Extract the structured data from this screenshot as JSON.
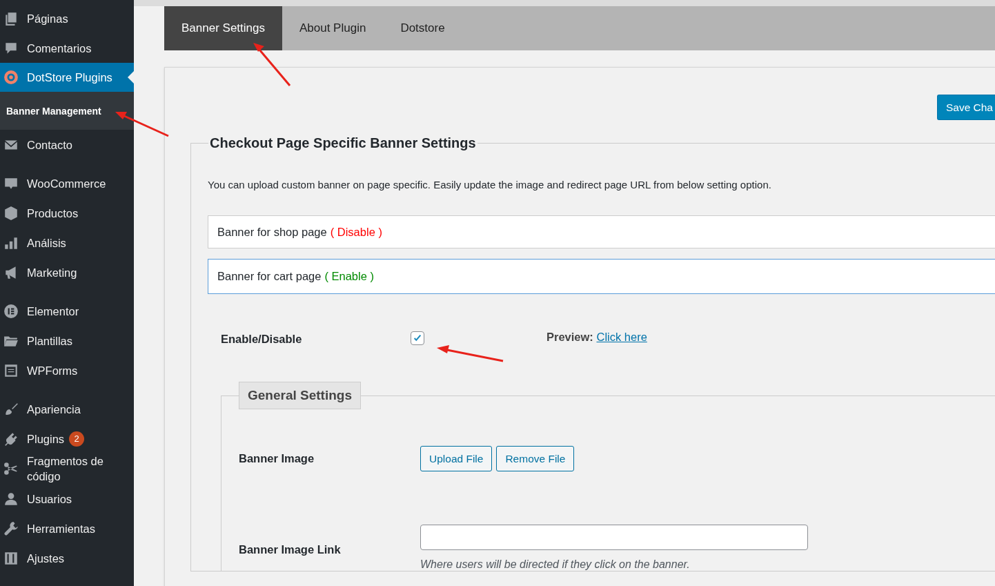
{
  "sidebar": {
    "sections": [
      {
        "items": [
          {
            "label": "Páginas",
            "selected": false
          },
          {
            "label": "Comentarios",
            "selected": false
          },
          {
            "label": "DotStore Plugins",
            "selected": true,
            "children": [
              {
                "label": "Banner Management",
                "selected": true
              }
            ]
          },
          {
            "label": "Contacto",
            "selected": false
          }
        ]
      },
      {
        "items": [
          {
            "label": "WooCommerce",
            "selected": false
          },
          {
            "label": "Productos",
            "selected": false
          },
          {
            "label": "Análisis",
            "selected": false
          },
          {
            "label": "Marketing",
            "selected": false
          }
        ]
      },
      {
        "items": [
          {
            "label": "Elementor",
            "selected": false
          },
          {
            "label": "Plantillas",
            "selected": false
          },
          {
            "label": "WPForms",
            "selected": false
          }
        ]
      },
      {
        "items": [
          {
            "label": "Apariencia",
            "selected": false
          },
          {
            "label": "Plugins",
            "selected": false,
            "badge": "2"
          },
          {
            "label": "Fragmentos de código",
            "selected": false
          },
          {
            "label": "Usuarios",
            "selected": false
          },
          {
            "label": "Herramientas",
            "selected": false
          },
          {
            "label": "Ajustes",
            "selected": false
          }
        ]
      }
    ]
  },
  "tabs": [
    {
      "label": "Banner Settings",
      "selected": true
    },
    {
      "label": "About Plugin",
      "selected": false
    },
    {
      "label": "Dotstore",
      "selected": false
    }
  ],
  "save_button": "Save Cha",
  "settings": {
    "legend": "Checkout Page Specific Banner Settings",
    "description": "You can upload custom banner on page specific. Easily update the image and redirect page URL from below setting option.",
    "accordions": [
      {
        "title": "Banner for shop page",
        "status": "( Disable )",
        "enabled": false,
        "expanded": false
      },
      {
        "title": "Banner for cart page",
        "status": "( Enable )",
        "enabled": true,
        "expanded": true,
        "content": {
          "enable_label": "Enable/Disable",
          "checked": true,
          "preview_label": "Preview:",
          "preview_link": "Click here",
          "general": {
            "legend": "General Settings",
            "fields": [
              {
                "kind": "upload",
                "label": "Banner Image",
                "buttons": [
                  "Upload File",
                  "Remove File"
                ]
              },
              {
                "kind": "link",
                "label": "Banner Image Link",
                "hint": "Where users will be directed if they click on the banner."
              }
            ]
          }
        }
      }
    ]
  }
}
